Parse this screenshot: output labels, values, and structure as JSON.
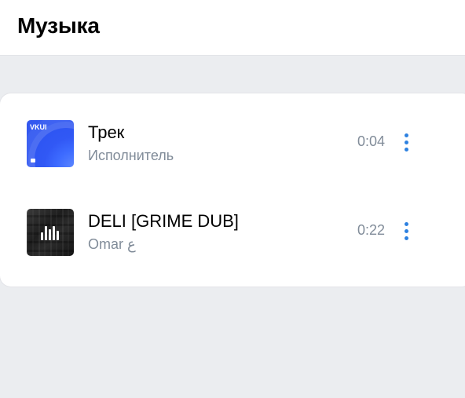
{
  "header": {
    "title": "Музыка"
  },
  "tracks": [
    {
      "title": "Трек",
      "artist": "Исполнитель",
      "duration": "0:04",
      "cover_label": "VKUI",
      "cover_icon": "vkui-cover-icon"
    },
    {
      "title": "DELI [GRIME DUB]",
      "artist": "Omar ع",
      "duration": "0:22",
      "cover_icon": "equalizer-cover-icon"
    }
  ],
  "colors": {
    "accent": "#2d81e0",
    "secondary_text": "#818c99",
    "background": "#ebedf0",
    "card": "#ffffff",
    "vkui_cover": "#2b51ee"
  },
  "icons": {
    "more": "more-vertical-icon"
  }
}
